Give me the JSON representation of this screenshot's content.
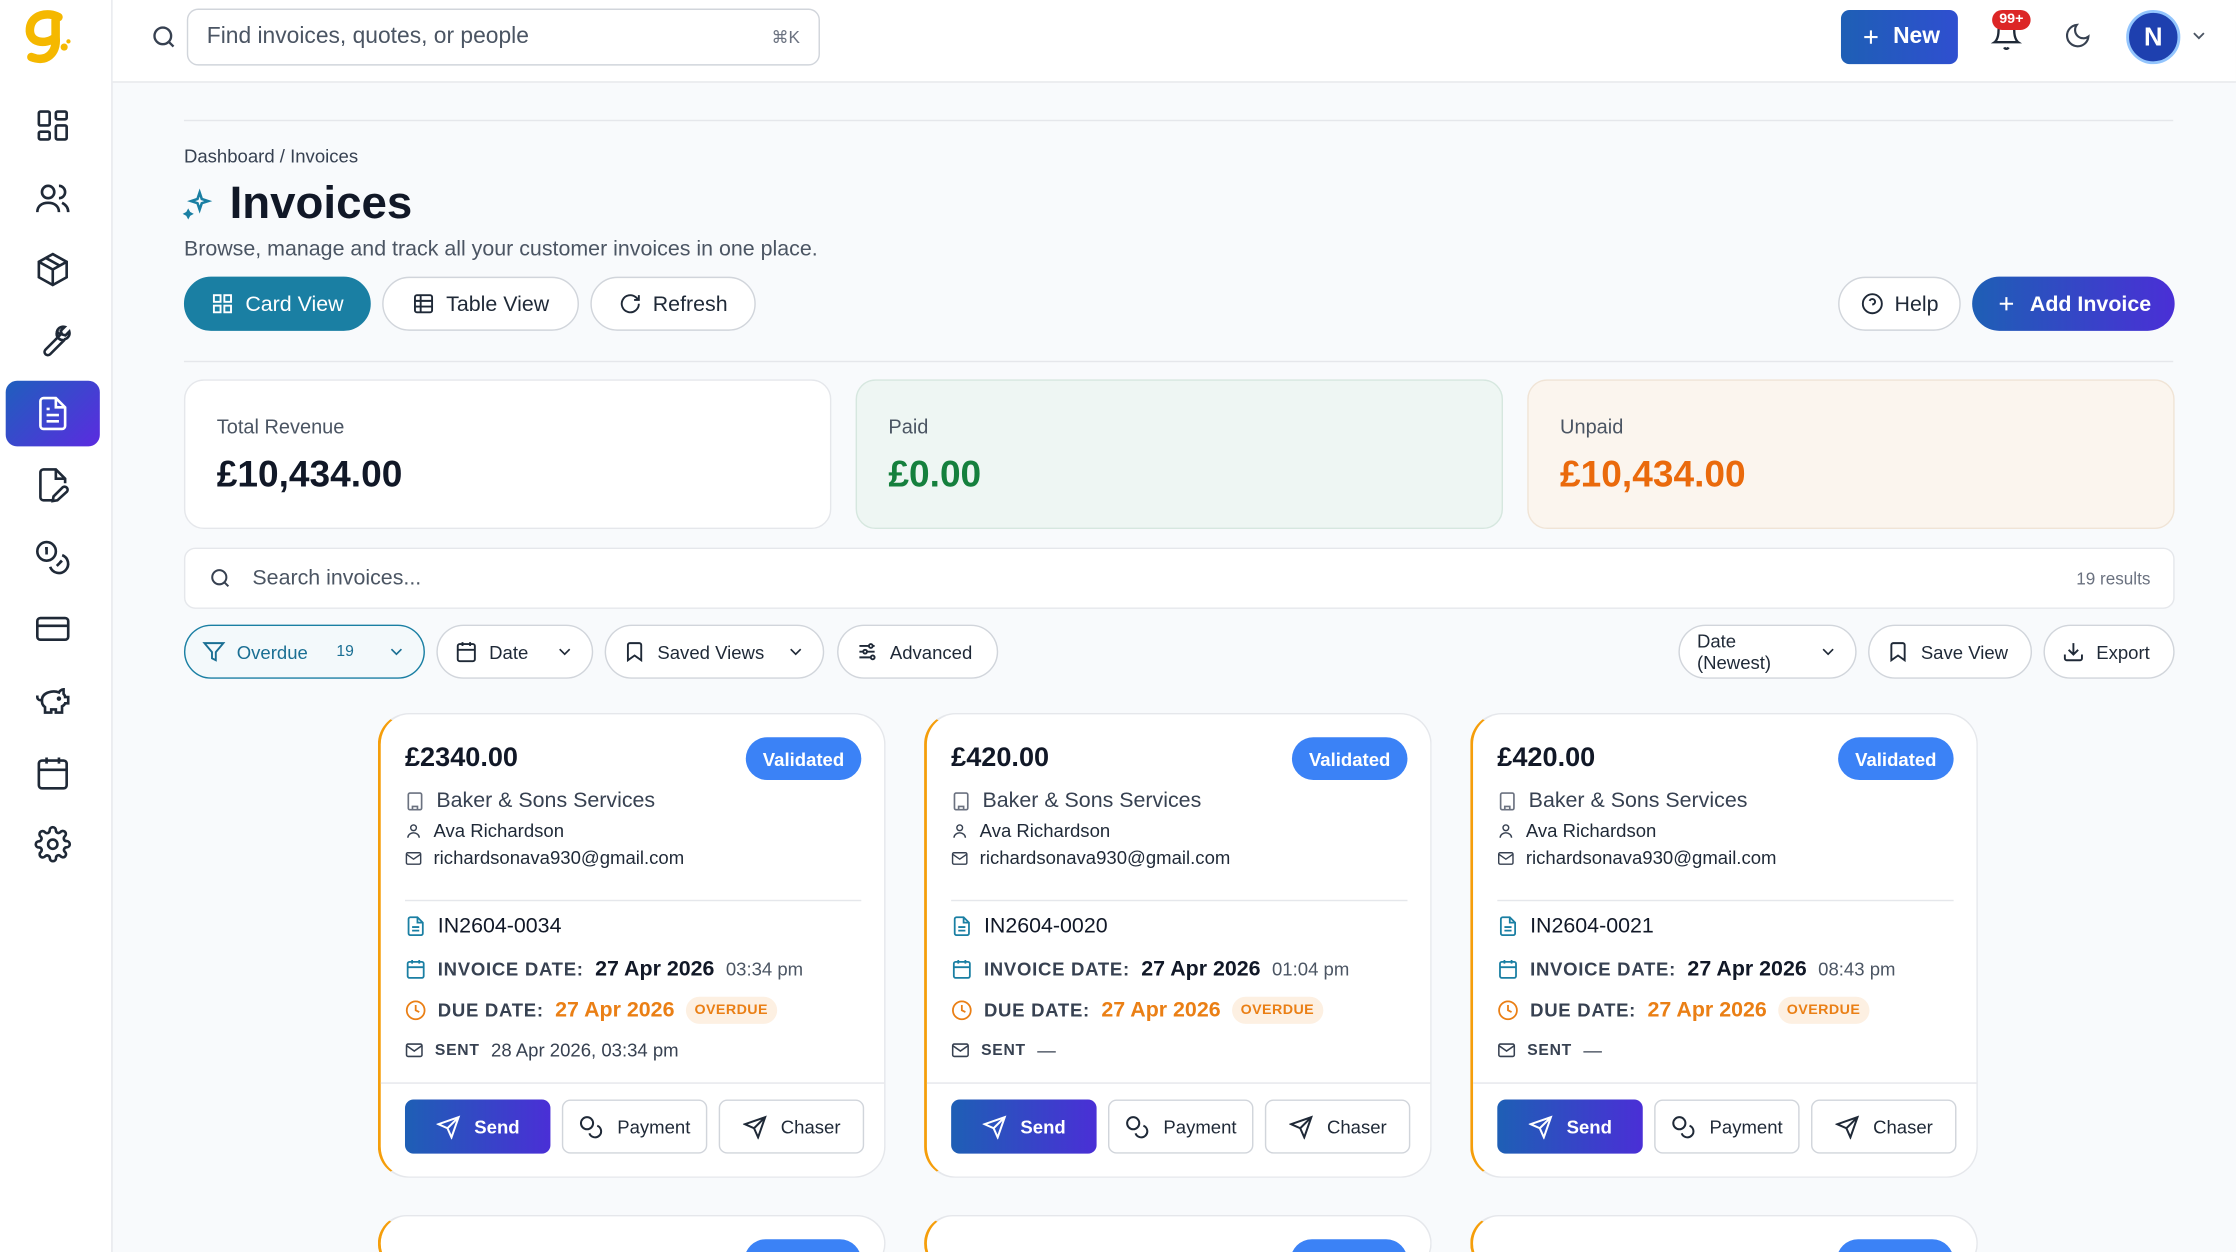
{
  "app": {
    "logo_letter": "g"
  },
  "topbar": {
    "search_placeholder": "Find invoices, quotes, or people",
    "search_shortcut": "⌘K",
    "new_label": "New",
    "notification_badge": "99+",
    "avatar_initial": "N"
  },
  "sidebar": {
    "items": [
      {
        "icon": "dashboard-icon"
      },
      {
        "icon": "users-icon"
      },
      {
        "icon": "box-icon"
      },
      {
        "icon": "wrench-icon"
      },
      {
        "icon": "invoice-icon",
        "active": true
      },
      {
        "icon": "edit-document-icon"
      },
      {
        "icon": "coins-icon"
      },
      {
        "icon": "credit-card-icon"
      },
      {
        "icon": "piggy-bank-icon"
      },
      {
        "icon": "calendar-icon"
      },
      {
        "icon": "settings-icon"
      }
    ]
  },
  "page": {
    "breadcrumb": "Dashboard / Invoices",
    "title": "Invoices",
    "subtitle": "Browse, manage and track all your customer invoices in one place.",
    "card_view": "Card View",
    "table_view": "Table View",
    "refresh": "Refresh",
    "help": "Help",
    "add_invoice": "Add Invoice"
  },
  "stats": {
    "total_label": "Total Revenue",
    "total_value": "£10,434.00",
    "paid_label": "Paid",
    "paid_value": "£0.00",
    "unpaid_label": "Unpaid",
    "unpaid_value": "£10,434.00"
  },
  "search": {
    "placeholder": "Search invoices...",
    "results": "19 results"
  },
  "filters": {
    "overdue": "Overdue",
    "overdue_count": "19",
    "date": "Date",
    "saved_views": "Saved Views",
    "advanced": "Advanced",
    "sort": "Date (Newest)",
    "save_view": "Save View",
    "export": "Export"
  },
  "labels": {
    "invoice_date": "INVOICE DATE:",
    "due_date": "DUE DATE:",
    "sent": "SENT",
    "overdue": "OVERDUE",
    "send": "Send",
    "payment": "Payment",
    "chaser": "Chaser"
  },
  "invoices": [
    {
      "amount": "£2340.00",
      "status": "Validated",
      "company": "Baker & Sons Services",
      "contact": "Ava Richardson",
      "email": "richardsonava930@gmail.com",
      "number": "IN2604-0034",
      "invoice_date": "27 Apr 2026",
      "invoice_time": "03:34 pm",
      "due_date": "27 Apr 2026",
      "sent": "28 Apr 2026, 03:34 pm"
    },
    {
      "amount": "£420.00",
      "status": "Validated",
      "company": "Baker & Sons Services",
      "contact": "Ava Richardson",
      "email": "richardsonava930@gmail.com",
      "number": "IN2604-0020",
      "invoice_date": "27 Apr 2026",
      "invoice_time": "01:04 pm",
      "due_date": "27 Apr 2026",
      "sent": "—"
    },
    {
      "amount": "£420.00",
      "status": "Validated",
      "company": "Baker & Sons Services",
      "contact": "Ava Richardson",
      "email": "richardsonava930@gmail.com",
      "number": "IN2604-0021",
      "invoice_date": "27 Apr 2026",
      "invoice_time": "08:43 pm",
      "due_date": "27 Apr 2026",
      "sent": "—"
    }
  ]
}
